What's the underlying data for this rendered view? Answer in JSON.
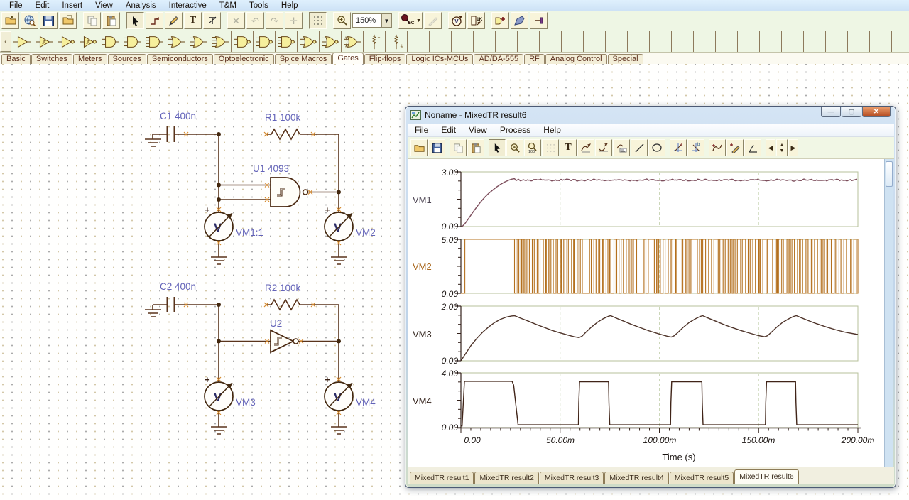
{
  "app": {
    "menu": [
      "File",
      "Edit",
      "Insert",
      "View",
      "Analysis",
      "Interactive",
      "T&M",
      "Tools",
      "Help"
    ],
    "toolbar": {
      "zoom_value": "150%",
      "text_tool": "T",
      "dc_label": "DC",
      "k1_label": "1K"
    },
    "component_tabs": [
      {
        "label": "Basic"
      },
      {
        "label": "Switches"
      },
      {
        "label": "Meters"
      },
      {
        "label": "Sources"
      },
      {
        "label": "Semiconductors"
      },
      {
        "label": "Optoelectronic"
      },
      {
        "label": "Spice Macros"
      },
      {
        "label": "Gates",
        "active": true
      },
      {
        "label": "Flip-flops"
      },
      {
        "label": "Logic ICs-MCUs"
      },
      {
        "label": "AD/DA-555"
      },
      {
        "label": "RF"
      },
      {
        "label": "Analog Control"
      },
      {
        "label": "Special"
      }
    ],
    "gate_icons": [
      "buffer",
      "controlled-buffer",
      "inverter",
      "schmitt-inverter",
      "and2",
      "and3",
      "and4",
      "or2",
      "or3",
      "or4",
      "nand2",
      "nand3",
      "nand4",
      "nor2",
      "nor3",
      "xor2",
      "pullup-resistor",
      "pulldown-resistor"
    ]
  },
  "schematic": {
    "c1": "C1 400n",
    "r1": "R1 100k",
    "u1": "U1 4093",
    "vm1": "VM1:1",
    "vm2": "VM2",
    "c2": "C2 400n",
    "r2": "R2 100k",
    "u2": "U2",
    "vm3": "VM3",
    "vm4": "VM4",
    "meter_letter": "V",
    "plus": "+",
    "wire_color": "#5a341c",
    "label_color": "#6363b8",
    "pin_color": "#d68a2e"
  },
  "result_window": {
    "title": "Noname - MixedTR result6",
    "menu": [
      "File",
      "Edit",
      "View",
      "Process",
      "Help"
    ],
    "toolbar": {
      "text_tool": "T",
      "zoom_out_label": "100"
    },
    "x_ticks": [
      "0.00",
      "50.00m",
      "100.00m",
      "150.00m",
      "200.00m"
    ],
    "xlabel": "Time (s)",
    "tabs": [
      {
        "label": "MixedTR result1"
      },
      {
        "label": "MixedTR result2"
      },
      {
        "label": "MixedTR result3"
      },
      {
        "label": "MixedTR result4"
      },
      {
        "label": "MixedTR result5"
      },
      {
        "label": "MixedTR result6",
        "active": true
      }
    ]
  },
  "chart_data": [
    {
      "type": "line",
      "name": "VM1",
      "ylim": [
        0,
        3
      ],
      "ymax_label": "3.00",
      "ymin_label": "0.00",
      "color": "#7d4e5c",
      "label_color": "#4c4452",
      "x_range_ms": [
        0,
        200
      ],
      "x_gridlines_ms": [
        50,
        100,
        150
      ],
      "points": [
        [
          0,
          0
        ],
        [
          0.8,
          0.02
        ],
        [
          2,
          0.16
        ],
        [
          4,
          0.46
        ],
        [
          6,
          0.78
        ],
        [
          8,
          1.08
        ],
        [
          10,
          1.36
        ],
        [
          12,
          1.6
        ],
        [
          14,
          1.82
        ],
        [
          16,
          2.0
        ],
        [
          18,
          2.17
        ],
        [
          20,
          2.32
        ],
        [
          22,
          2.44
        ],
        [
          24,
          2.54
        ],
        [
          25.5,
          2.6
        ],
        [
          27,
          2.63
        ],
        [
          27.8,
          2.52
        ],
        [
          29,
          2.59
        ],
        [
          30,
          2.51
        ],
        [
          31.5,
          2.57
        ],
        [
          32.5,
          2.53
        ]
      ],
      "flat": {
        "from": 32.5,
        "to": 200,
        "level": 2.55,
        "ripple": 0.05
      }
    },
    {
      "type": "square",
      "name": "VM2",
      "ylim": [
        0,
        5
      ],
      "ymax_label": "5.00",
      "ymin_label": "0.00",
      "color": "#b4701e",
      "label_color": "#a8651a",
      "x_range_ms": [
        0,
        200
      ],
      "x_gridlines_ms": [
        50,
        100,
        150
      ],
      "steps": [
        [
          0,
          0
        ],
        [
          2,
          5
        ],
        [
          27,
          0
        ]
      ],
      "burst": {
        "from": 27,
        "to": 200,
        "low": 0,
        "high": 5,
        "min_half_ms": 0.35,
        "max_half_ms": 1.7
      }
    },
    {
      "type": "line",
      "name": "VM3",
      "ylim": [
        0,
        2
      ],
      "ymax_label": "2.00",
      "ymin_label": "0.00",
      "color": "#4f342a",
      "label_color": "#3c2f28",
      "x_range_ms": [
        0,
        200
      ],
      "x_gridlines_ms": [
        50,
        100,
        150
      ],
      "points": [
        [
          0,
          0
        ],
        [
          2,
          0.22
        ],
        [
          5,
          0.55
        ],
        [
          8,
          0.82
        ],
        [
          11,
          1.05
        ],
        [
          14,
          1.24
        ],
        [
          17,
          1.4
        ],
        [
          20,
          1.52
        ],
        [
          23,
          1.6
        ],
        [
          25.5,
          1.64
        ],
        [
          27,
          1.65
        ],
        [
          30,
          1.56
        ],
        [
          34,
          1.45
        ],
        [
          38,
          1.33
        ],
        [
          42,
          1.22
        ],
        [
          46,
          1.11
        ],
        [
          50,
          1.02
        ],
        [
          54,
          0.94
        ],
        [
          57,
          0.88
        ],
        [
          59.5,
          0.85
        ],
        [
          61,
          0.9
        ],
        [
          63,
          1.05
        ],
        [
          66,
          1.25
        ],
        [
          69,
          1.42
        ],
        [
          72,
          1.55
        ],
        [
          74.5,
          1.63
        ],
        [
          75.5,
          1.65
        ],
        [
          78,
          1.57
        ],
        [
          82,
          1.45
        ],
        [
          86,
          1.33
        ],
        [
          90,
          1.22
        ],
        [
          95,
          1.09
        ],
        [
          100,
          0.98
        ],
        [
          104,
          0.9
        ],
        [
          106,
          0.87
        ],
        [
          107.5,
          0.92
        ],
        [
          109.5,
          1.05
        ],
        [
          112,
          1.22
        ],
        [
          115,
          1.4
        ],
        [
          118,
          1.53
        ],
        [
          120.5,
          1.62
        ],
        [
          121.8,
          1.65
        ],
        [
          124,
          1.58
        ],
        [
          128,
          1.46
        ],
        [
          132,
          1.34
        ],
        [
          136,
          1.23
        ],
        [
          141,
          1.11
        ],
        [
          146,
          1.0
        ],
        [
          150,
          0.92
        ],
        [
          153,
          0.88
        ],
        [
          154.5,
          0.92
        ],
        [
          156.5,
          1.05
        ],
        [
          159,
          1.22
        ],
        [
          162,
          1.4
        ],
        [
          165,
          1.53
        ],
        [
          167.5,
          1.62
        ],
        [
          169,
          1.65
        ],
        [
          171,
          1.59
        ],
        [
          175,
          1.47
        ],
        [
          179,
          1.36
        ],
        [
          184,
          1.24
        ],
        [
          189,
          1.13
        ],
        [
          194,
          1.04
        ],
        [
          200,
          0.96
        ]
      ]
    },
    {
      "type": "line",
      "name": "VM4",
      "ylim": [
        0,
        4
      ],
      "ymax_label": "4.00",
      "ymin_label": "0.00",
      "color": "#402418",
      "label_color": "#33211a",
      "x_range_ms": [
        0,
        200
      ],
      "x_gridlines_ms": [
        50,
        100,
        150
      ],
      "points": [
        [
          0,
          0.12
        ],
        [
          0.6,
          0.12
        ],
        [
          1.8,
          3.38
        ],
        [
          25.8,
          3.38
        ],
        [
          26.6,
          3.1
        ],
        [
          28.8,
          0.2
        ],
        [
          59.2,
          0.2
        ],
        [
          59.4,
          1.8
        ],
        [
          59.8,
          3.35
        ],
        [
          74.4,
          3.35
        ],
        [
          74.6,
          1.8
        ],
        [
          75,
          0.2
        ],
        [
          105.6,
          0.2
        ],
        [
          105.8,
          1.8
        ],
        [
          106.2,
          3.35
        ],
        [
          121.4,
          3.35
        ],
        [
          121.6,
          1.8
        ],
        [
          122,
          0.2
        ],
        [
          153.4,
          0.2
        ],
        [
          153.6,
          1.8
        ],
        [
          154,
          3.35
        ],
        [
          168.6,
          3.35
        ],
        [
          168.8,
          1.8
        ],
        [
          169.2,
          0.2
        ],
        [
          200,
          0.2
        ]
      ]
    }
  ]
}
